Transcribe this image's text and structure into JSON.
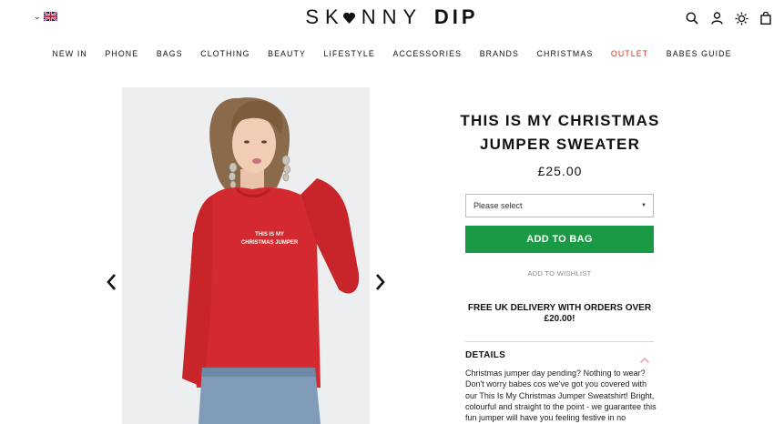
{
  "header": {
    "logo_left": "SK",
    "logo_mid": "NNY",
    "logo_bold": "DIP"
  },
  "nav": {
    "items": [
      "NEW IN",
      "PHONE",
      "BAGS",
      "CLOTHING",
      "BEAUTY",
      "LIFESTYLE",
      "ACCESSORIES",
      "BRANDS",
      "CHRISTMAS",
      "OUTLET",
      "BABES GUIDE"
    ]
  },
  "product": {
    "title": "THIS IS MY CHRISTMAS JUMPER SWEATER",
    "price": "£25.00",
    "shirt_print_line1": "THIS IS MY",
    "shirt_print_line2": "CHRISTMAS JUMPER",
    "size_select": "Please select",
    "add_to_bag": "ADD TO BAG",
    "wishlist": "ADD TO WISHLIST",
    "delivery": "FREE UK DELIVERY WITH ORDERS OVER £20.00!",
    "details_heading": "DETAILS",
    "details_text": "Christmas jumper day pending? Nothing to wear? Don't worry babes cos we've got you covered with our This Is My Christmas Jumper Sweatshirt! Bright, colourful and straight to the point - we guarantee this fun jumper will have you feeling festive in no"
  },
  "colors": {
    "accent_green": "#1a9a45",
    "outlet_red": "#d9312b",
    "sweater_red": "#d42a2f",
    "chevron_pink": "#e8a9b0"
  },
  "icons": [
    "chevron-down-icon",
    "uk-flag-icon",
    "search-icon",
    "user-icon",
    "sun-icon",
    "bag-icon",
    "arrow-left-icon",
    "arrow-right-icon",
    "chevron-up-icon"
  ]
}
